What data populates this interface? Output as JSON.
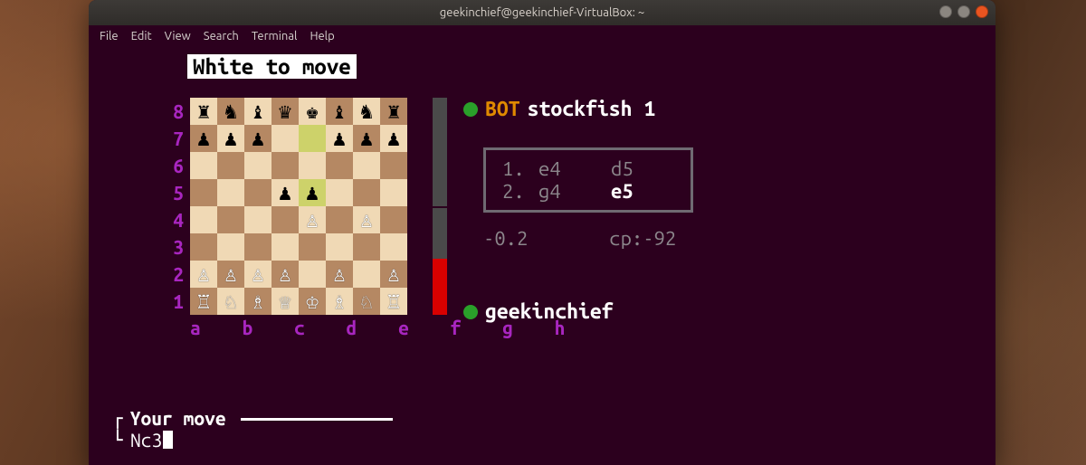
{
  "window": {
    "title": "geekinchief@geekinchief-VirtualBox: ~"
  },
  "menubar": [
    "File",
    "Edit",
    "View",
    "Search",
    "Terminal",
    "Help"
  ],
  "game": {
    "status": "White to move",
    "ranks": [
      "8",
      "7",
      "6",
      "5",
      "4",
      "3",
      "2",
      "1"
    ],
    "files": "a b c d e f g h",
    "top_player": {
      "tag": "BOT",
      "name": "stockfish 1"
    },
    "bottom_player": {
      "name": "geekinchief"
    },
    "moves": [
      {
        "num": "1.",
        "white": "e4",
        "black": "d5"
      },
      {
        "num": "2.",
        "white": "g4",
        "black": "e5"
      }
    ],
    "eval_human": "-0.2",
    "eval_cp": "cp:-92",
    "eval_bar_black_pct": 26
  },
  "board": {
    "rows": [
      [
        [
          "r",
          "b"
        ],
        [
          "n",
          "b"
        ],
        [
          "b",
          "b"
        ],
        [
          "q",
          "b"
        ],
        [
          "k",
          "b"
        ],
        [
          "b",
          "b"
        ],
        [
          "n",
          "b"
        ],
        [
          "r",
          "b"
        ]
      ],
      [
        [
          "p",
          "b"
        ],
        [
          "p",
          "b"
        ],
        [
          "p",
          "b"
        ],
        [
          "",
          ""
        ],
        [
          "",
          "",
          "hl"
        ],
        [
          "p",
          "b"
        ],
        [
          "p",
          "b"
        ],
        [
          "p",
          "b"
        ]
      ],
      [
        [
          "",
          ""
        ],
        [
          "",
          ""
        ],
        [
          "",
          ""
        ],
        [
          "",
          ""
        ],
        [
          "",
          ""
        ],
        [
          "",
          ""
        ],
        [
          "",
          ""
        ],
        [
          "",
          ""
        ]
      ],
      [
        [
          "",
          ""
        ],
        [
          "",
          ""
        ],
        [
          "",
          ""
        ],
        [
          "p",
          "b"
        ],
        [
          "p",
          "b",
          "hl"
        ],
        [
          "",
          ""
        ],
        [
          "",
          ""
        ],
        [
          "",
          ""
        ]
      ],
      [
        [
          "",
          ""
        ],
        [
          "",
          ""
        ],
        [
          "",
          ""
        ],
        [
          "",
          ""
        ],
        [
          "P",
          "w"
        ],
        [
          "",
          ""
        ],
        [
          "P",
          "w"
        ],
        [
          "",
          ""
        ]
      ],
      [
        [
          "",
          ""
        ],
        [
          "",
          ""
        ],
        [
          "",
          ""
        ],
        [
          "",
          ""
        ],
        [
          "",
          ""
        ],
        [
          "",
          ""
        ],
        [
          "",
          ""
        ],
        [
          "",
          ""
        ]
      ],
      [
        [
          "P",
          "w"
        ],
        [
          "P",
          "w"
        ],
        [
          "P",
          "w"
        ],
        [
          "P",
          "w"
        ],
        [
          "",
          ""
        ],
        [
          "P",
          "w"
        ],
        [
          "",
          ""
        ],
        [
          "P",
          "w"
        ]
      ],
      [
        [
          "R",
          "w"
        ],
        [
          "N",
          "w"
        ],
        [
          "B",
          "w"
        ],
        [
          "Q",
          "w"
        ],
        [
          "K",
          "w"
        ],
        [
          "B",
          "w"
        ],
        [
          "N",
          "w"
        ],
        [
          "R",
          "w"
        ]
      ]
    ]
  },
  "piece_glyphs": {
    "K": "♔",
    "Q": "♕",
    "R": "♖",
    "B": "♗",
    "N": "♘",
    "P": "♙",
    "k": "♚",
    "q": "♛",
    "r": "♜",
    "b": "♝",
    "n": "♞",
    "p": "♟"
  },
  "prompt": {
    "label": "Your move",
    "input": "Nc3"
  }
}
